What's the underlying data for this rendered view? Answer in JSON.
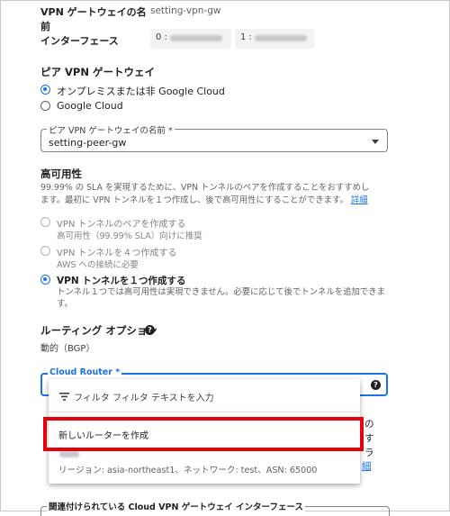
{
  "gateway": {
    "name_label_line1": "VPN ゲートウェイの名",
    "name_label_line2": "前",
    "name_value": "setting-vpn-gw",
    "interface_label": "インターフェース",
    "interfaces": [
      {
        "index": "0 :"
      },
      {
        "index": "1 :"
      }
    ]
  },
  "peer_gateway": {
    "section_title": "ピア VPN ゲートウェイ",
    "options": [
      {
        "label": "オンプレミスまたは非 Google Cloud",
        "selected": true
      },
      {
        "label": "Google Cloud",
        "selected": false
      }
    ],
    "name_field_label": "ピア VPN ゲートウェイの名前 *",
    "name_field_value": "setting-peer-gw"
  },
  "high_availability": {
    "section_title": "高可用性",
    "description_line1": "99.99% の SLA を実現するために、VPN トンネルのペアを作成することをおすすめし",
    "description_line2": "ます。最初に VPN トンネルを１つ作成し、後で高可用性にすることができます。",
    "details_link": "詳細",
    "options": [
      {
        "label": "VPN トンネルのペアを作成する",
        "sub": "高可用性（99.99% SLA）向けに推奨",
        "selected": false
      },
      {
        "label": "VPN トンネルを４つ作成する",
        "sub": "AWS への接続に必要",
        "selected": false
      },
      {
        "label": "VPN トンネルを１つ作成する",
        "sub_line1": "トンネル１つでは高可用性は実現できません。必要に応じて後でトンネルを追加できま",
        "sub_line2": "す。",
        "selected": true
      }
    ]
  },
  "routing": {
    "section_title": "ルーティング オプション",
    "value": "動的（BGP）"
  },
  "cloud_router": {
    "field_label": "Cloud Router *",
    "filter_placeholder": "フィルタ フィルタ テキストを入力",
    "create_new": "新しいルーターを作成",
    "existing_router_detail": "リージョン: asia-northeast1、ネットワーク: test、ASN: 65000",
    "peek_right": [
      "の",
      "す",
      "ラ"
    ],
    "peek_link": "細"
  },
  "bottom": {
    "section_title": "関連付けられている Cloud VPN ゲートウェイ インターフェース"
  },
  "colors": {
    "accent": "#1a73e8",
    "highlight": "#e8000b"
  }
}
